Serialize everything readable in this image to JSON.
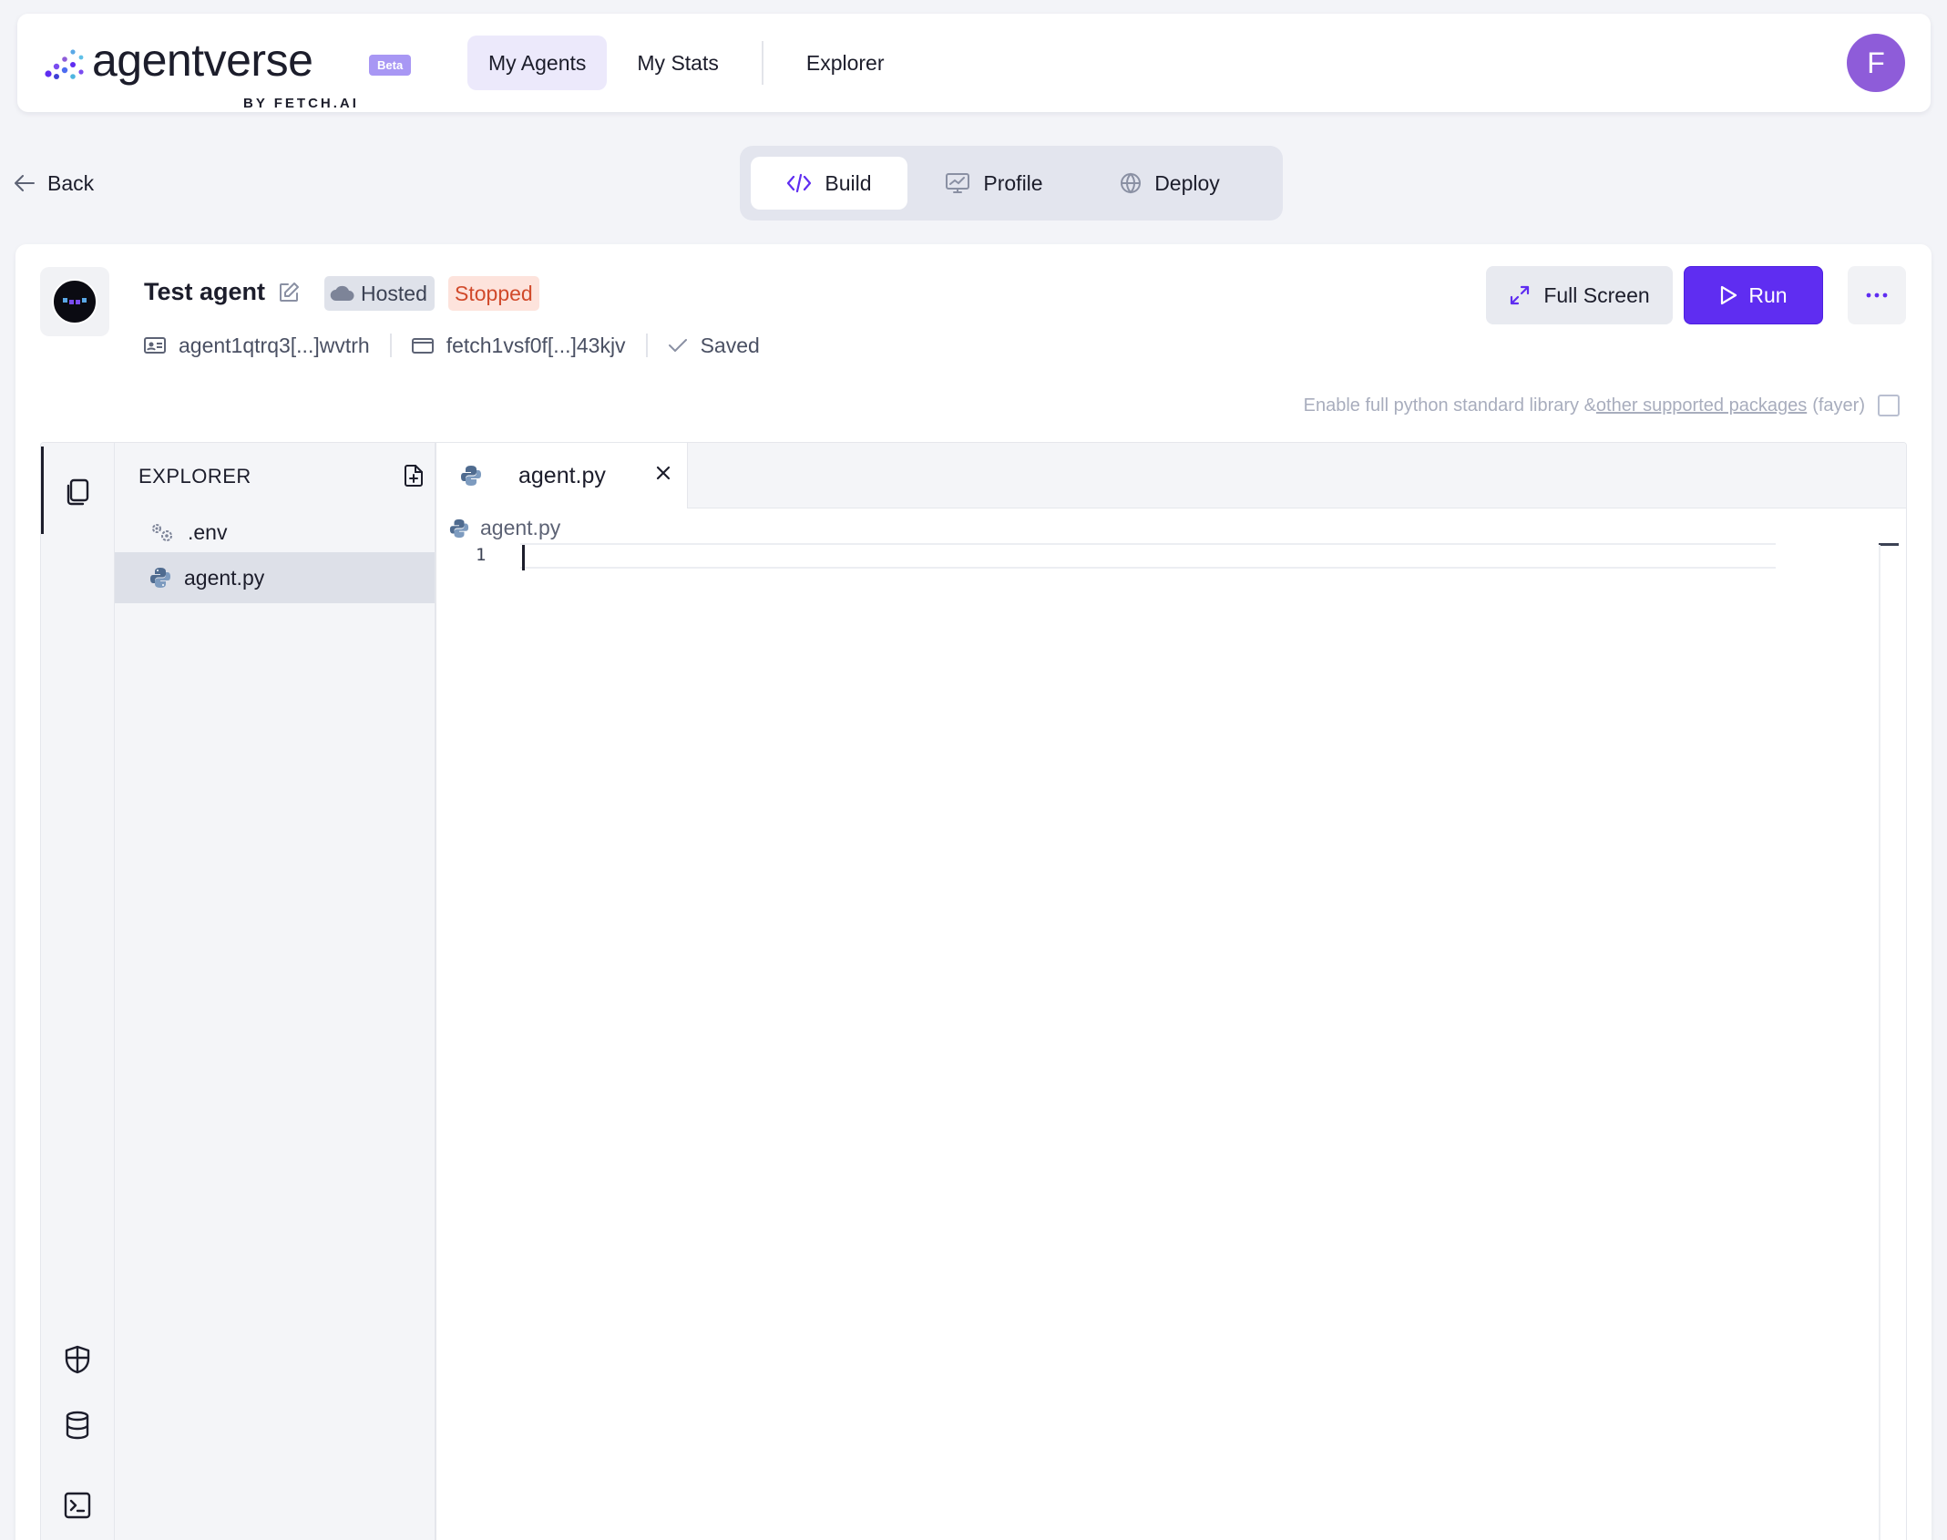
{
  "app": {
    "logo_text": "agentverse",
    "logo_badge": "Beta",
    "logo_sub": "BY FETCH.AI",
    "accent_color": "#5f2df1"
  },
  "nav": {
    "links": [
      {
        "label": "My Agents",
        "active": true
      },
      {
        "label": "My Stats",
        "active": false
      },
      {
        "label": "Explorer",
        "active": false
      }
    ],
    "avatar_letter": "F"
  },
  "back_label": "Back",
  "tabs": [
    {
      "label": "Build",
      "icon": "code-icon",
      "active": true
    },
    {
      "label": "Profile",
      "icon": "monitor-chart-icon",
      "active": false
    },
    {
      "label": "Deploy",
      "icon": "globe-icon",
      "active": false
    }
  ],
  "agent": {
    "name": "Test agent",
    "hosting_badge": "Hosted",
    "status_badge": "Stopped",
    "address": "agent1qtrq3[...]wvtrh",
    "wallet": "fetch1vsf0f[...]43kjv",
    "save_state": "Saved"
  },
  "actions": {
    "full_screen": "Full Screen",
    "run": "Run",
    "more": "more-horizontal-icon"
  },
  "stdlib": {
    "text": "Enable full python standard library &",
    "link": "other supported packages",
    "suffix": "(fayer)",
    "checked": false
  },
  "explorer": {
    "title": "EXPLORER",
    "files": [
      {
        "name": ".env",
        "icon": "gear-icon",
        "selected": false
      },
      {
        "name": "agent.py",
        "icon": "python-icon",
        "selected": true
      }
    ]
  },
  "editor": {
    "open_tab": "agent.py",
    "breadcrumb": "agent.py",
    "line_number": "1"
  }
}
